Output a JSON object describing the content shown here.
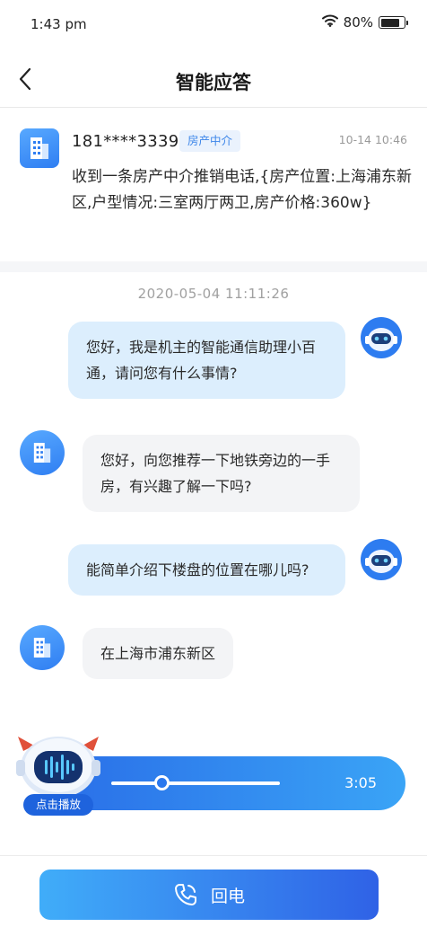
{
  "status_bar": {
    "time": "1:43 pm",
    "battery": "80%",
    "battery_level": 0.8
  },
  "nav": {
    "title": "智能应答"
  },
  "info_card": {
    "number": "181****3339",
    "tag": "房产中介",
    "time": "10-14  10:46",
    "summary": "收到一条房产中介推销电话,{房产位置:上海浦东新区,户型情况:三室两厅两卫,房产价格:360w}"
  },
  "chat": {
    "timestamp": "2020-05-04   11:11:26",
    "messages": [
      {
        "sender": "assistant",
        "text": "您好，我是机主的智能通信助理小百通，请问您有什么事情?"
      },
      {
        "sender": "caller",
        "text": "您好，向您推荐一下地铁旁边的一手房，有兴趣了解一下吗?"
      },
      {
        "sender": "assistant",
        "text": "能简单介绍下楼盘的位置在哪儿吗?"
      },
      {
        "sender": "caller",
        "text": "在上海市浦东新区"
      }
    ]
  },
  "audio": {
    "play_label": "点击播放",
    "duration": "3:05",
    "progress": 0.3
  },
  "footer": {
    "call_back_label": "回电"
  },
  "colors": {
    "accent": "#2f7ef2",
    "bubble_mine": "#dceefd",
    "bubble_other": "#f3f4f6",
    "tag_bg": "#eaf2fd"
  },
  "icons": {
    "back": "chevron-left-icon",
    "building": "building-icon",
    "robot": "robot-avatar-icon",
    "phone": "phone-icon"
  }
}
